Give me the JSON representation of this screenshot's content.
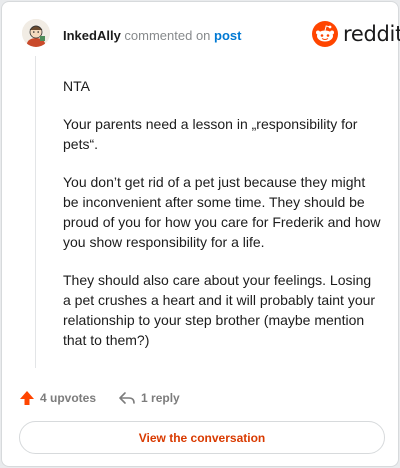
{
  "comment": {
    "username": "InkedAlly",
    "meta_text": "commented on",
    "post_link": "post",
    "brand": "reddit",
    "paragraphs": [
      "NTA",
      "Your parents need a lesson in „responsibility for pets“.",
      "You don’t get rid of a pet just because they might be inconvenient after some time. They should be proud of you for how you care for Frederik and how you show responsibility for a life.",
      "They should also care about your feelings. Losing a pet crushes a heart and it will probably taint your relationship to your step brother (maybe mention that to them?)"
    ]
  },
  "actions": {
    "upvotes": "4 upvotes",
    "replies": "1 reply"
  },
  "cta": {
    "label": "View the conversation"
  },
  "colors": {
    "reddit_orange": "#ff4500",
    "upvote": "#ff4500",
    "link_blue": "#0079d3",
    "cta_text": "#d93a00"
  },
  "icons": [
    "avatar",
    "reddit-logo-icon",
    "upvote-arrow-icon",
    "reply-icon"
  ]
}
